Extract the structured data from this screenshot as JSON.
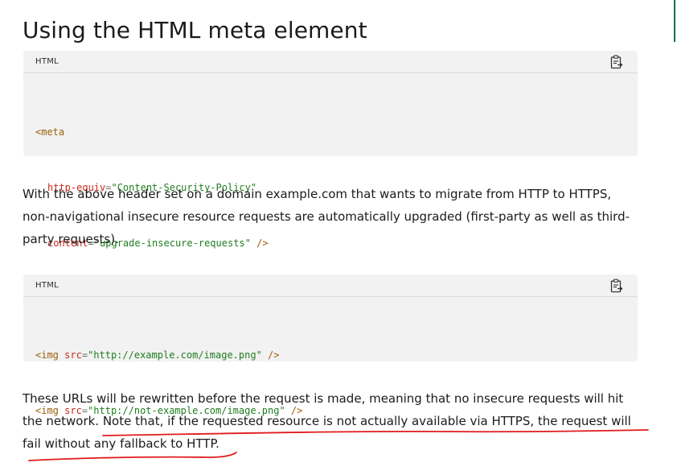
{
  "heading": "Using the HTML meta element",
  "code_blocks": [
    {
      "language": "HTML",
      "copy_icon": "clipboard-icon",
      "lines": [
        {
          "tag_open": "<meta"
        },
        {
          "attr": "http-equiv",
          "eq": "=",
          "value": "\"Content-Security-Policy\""
        },
        {
          "attr": "content",
          "eq": "=",
          "value": "\"upgrade-insecure-requests\"",
          "close": " />"
        }
      ]
    },
    {
      "language": "HTML",
      "copy_icon": "clipboard-icon",
      "lines": [
        {
          "tag": "<img",
          "attr": "src",
          "eq": "=",
          "value": "\"http://example.com/image.png\"",
          "close": " />"
        },
        {
          "tag": "<img",
          "attr": "src",
          "eq": "=",
          "value": "\"http://not-example.com/image.png\"",
          "close": " />"
        }
      ]
    }
  ],
  "paragraphs": [
    {
      "lines": [
        "With the above header set on a domain example.com that wants to migrate from HTTP to HTTPS,",
        "non-navigational insecure resource requests are automatically upgraded (first-party as well as third-",
        "party requests)."
      ]
    },
    {
      "lines": [
        "These URLs will be rewritten before the request is made, meaning that no insecure requests will hit",
        "the network. Note that, if the requested resource is not actually available via HTTPS, the request will",
        "fail without any fallback to HTTP."
      ]
    }
  ],
  "colors": {
    "annotation_stroke": "#e01b1b",
    "edge_accent": "#0b6b5a"
  }
}
